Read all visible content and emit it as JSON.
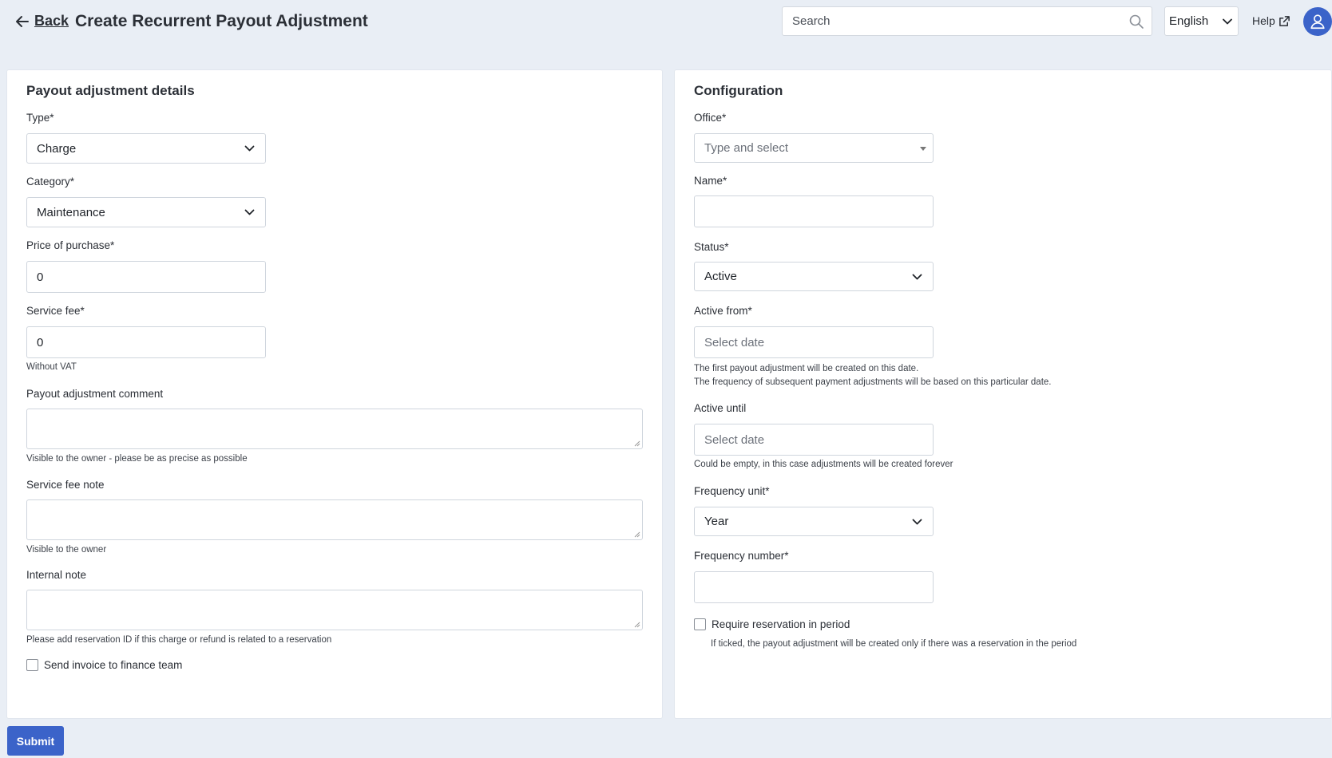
{
  "header": {
    "back_label": "Back",
    "title": "Create Recurrent Payout Adjustment",
    "search_placeholder": "Search",
    "language": "English",
    "help_label": "Help"
  },
  "details": {
    "title": "Payout adjustment details",
    "type_label": "Type*",
    "type_value": "Charge",
    "category_label": "Category*",
    "category_value": "Maintenance",
    "price_label": "Price of purchase*",
    "price_value": "0",
    "service_fee_label": "Service fee*",
    "service_fee_value": "0",
    "service_fee_hint": "Without VAT",
    "comment_label": "Payout adjustment comment",
    "comment_hint": "Visible to the owner - please be as precise as possible",
    "fee_note_label": "Service fee note",
    "fee_note_hint": "Visible to the owner",
    "internal_note_label": "Internal note",
    "internal_note_hint": "Please add reservation ID if this charge or refund is related to a reservation",
    "send_invoice_label": "Send invoice to finance team"
  },
  "config": {
    "title": "Configuration",
    "office_label": "Office*",
    "office_placeholder": "Type and select",
    "name_label": "Name*",
    "name_value": "",
    "status_label": "Status*",
    "status_value": "Active",
    "active_from_label": "Active from*",
    "active_from_placeholder": "Select date",
    "active_from_hint_1": "The first payout adjustment will be created on this date.",
    "active_from_hint_2": "The frequency of subsequent payment adjustments will be based on this particular date.",
    "active_until_label": "Active until",
    "active_until_placeholder": "Select date",
    "active_until_hint": "Could be empty, in this case adjustments will be created forever",
    "frequency_unit_label": "Frequency unit*",
    "frequency_unit_value": "Year",
    "frequency_number_label": "Frequency number*",
    "frequency_number_value": "",
    "require_reservation_label": "Require reservation in period",
    "require_reservation_hint": "If ticked, the payout adjustment will be created only if there was a reservation in the period"
  },
  "submit_label": "Submit",
  "colors": {
    "background": "#e9eef5",
    "primary": "#3b63c9",
    "card": "#ffffff"
  },
  "icons": [
    "arrow-left-icon",
    "search-icon",
    "chevron-down-icon",
    "external-link-icon",
    "user-icon",
    "caret-down-icon",
    "checkbox"
  ]
}
